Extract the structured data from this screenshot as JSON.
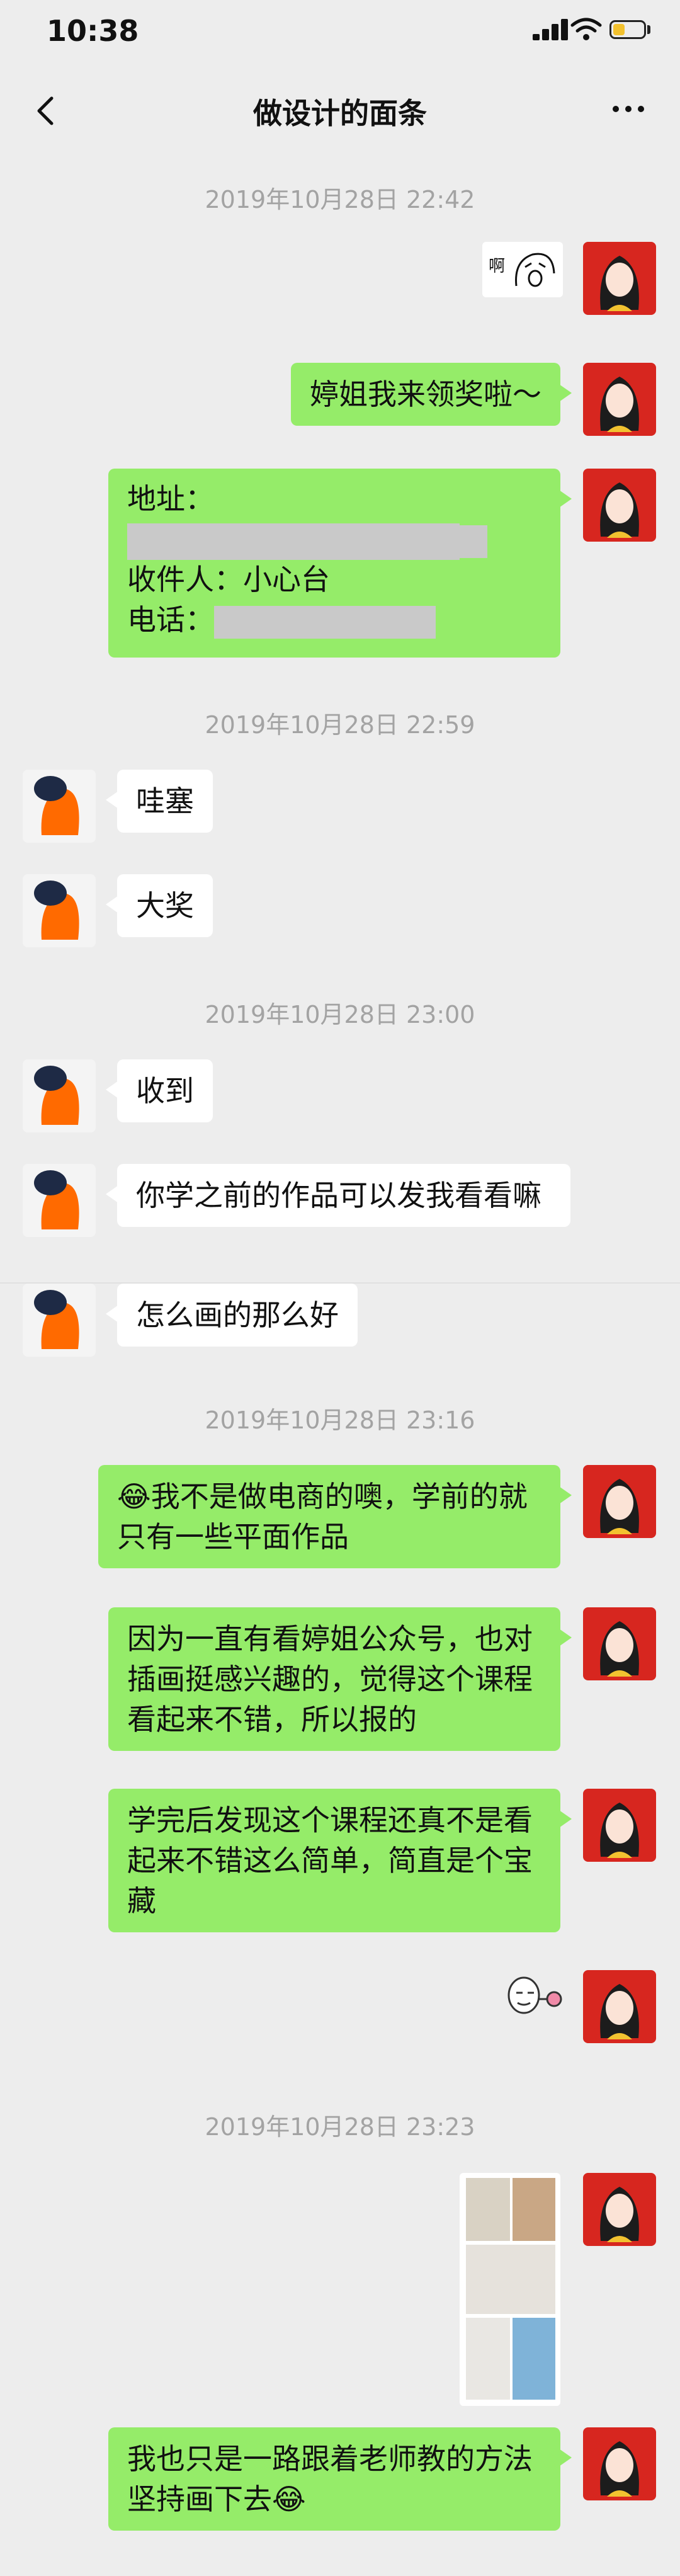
{
  "status_bar": {
    "time": "10:38"
  },
  "nav": {
    "title": "做设计的面条"
  },
  "timestamps": [
    "2019年10月28日 22:42",
    "2019年10月28日 22:59",
    "2019年10月28日 23:00",
    "2019年10月28日 23:16",
    "2019年10月28日 23:23"
  ],
  "messages": {
    "m1": "婷姐我来领奖啦～",
    "m2_address_label": "地址：",
    "m2_recipient": "收件人：小心台",
    "m2_phone_label": "电话：",
    "m3": "哇塞",
    "m4": "大奖",
    "m5": "收到",
    "m6": "你学之前的作品可以发我看看嘛",
    "m7": "怎么画的那么好",
    "m8": "我不是做电商的噢，学前的就只有一些平面作品",
    "m9": "因为一直有看婷姐公众号，也对插画挺感兴趣的，觉得这个课程看起来不错，所以报的",
    "m10": "学完后发现这个课程还真不是看起来不错这么简单，简直是个宝藏",
    "m11": "我也只是一路跟着老师教的方法坚持画下去",
    "sticker1_text": "啊"
  },
  "emoji": {
    "laugh_cry": "😂"
  },
  "colors": {
    "my_bubble": "#95ec69",
    "their_bubble": "#ffffff",
    "background": "#ededed",
    "my_avatar": "#d7261f",
    "their_avatar_accent": "#ff6a00"
  }
}
